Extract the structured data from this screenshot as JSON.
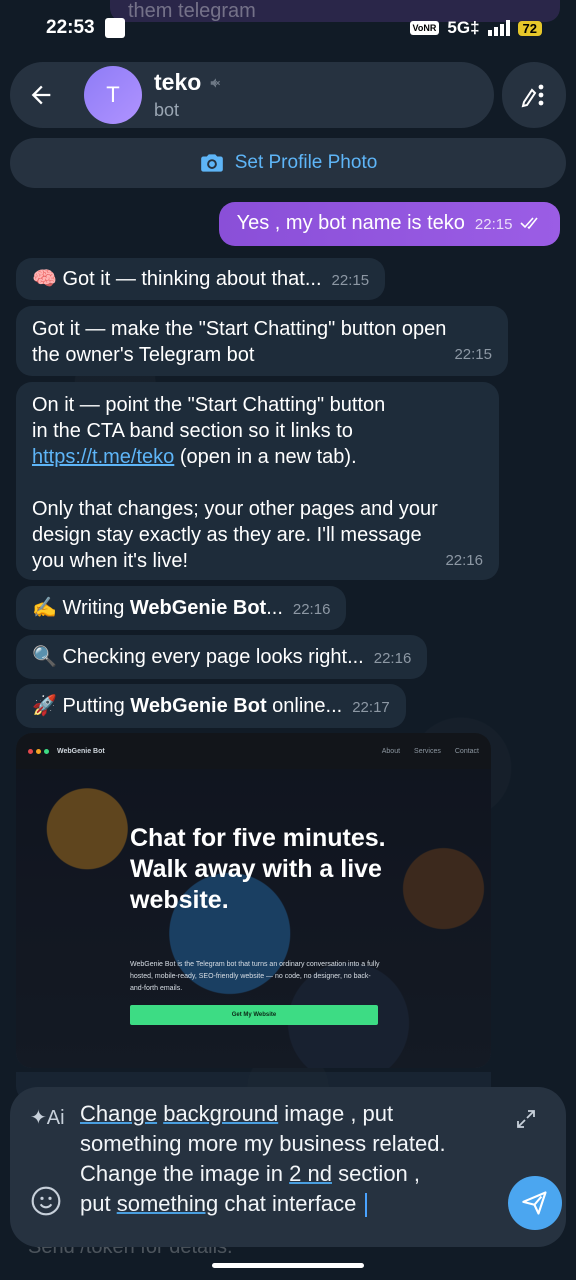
{
  "status_bar": {
    "time": "22:53",
    "volte": "VoNR",
    "network": "5G‡",
    "battery": "72"
  },
  "ghost": {
    "top_text": "them telegram",
    "bottom_text": "Send /token for details."
  },
  "header": {
    "avatar_letter": "T",
    "name": "teko",
    "subtitle": "bot",
    "set_photo_label": "Set Profile Photo"
  },
  "messages": {
    "outgoing": {
      "text": "Yes , my bot name is teko",
      "time": "22:15"
    },
    "m1": {
      "emoji": "🧠",
      "text": "Got it — thinking about that...",
      "time": "22:15"
    },
    "m2": {
      "line1": "Got it — make the \"Start Chatting\" button open",
      "line2": "the owner's Telegram bot",
      "time": "22:15"
    },
    "m3": {
      "line1": "On it — point the \"Start Chatting\" button",
      "line2": "in the CTA band section so it links to",
      "link": "https://t.me/teko",
      "after_link": " (open in a new tab).",
      "line4": "Only that changes; your other pages and your",
      "line5": "design stay exactly as they are. I'll message",
      "line6": "you when it's live!",
      "time": "22:16"
    },
    "m4": {
      "emoji": "✍️",
      "prefix": "Writing ",
      "bold": "WebGenie Bot",
      "suffix": "...",
      "time": "22:16"
    },
    "m5": {
      "emoji": "🔍",
      "text": "Checking every page looks right...",
      "time": "22:16"
    },
    "m6": {
      "emoji": "🚀",
      "prefix": "Putting ",
      "bold": "WebGenie Bot",
      "suffix": " online...",
      "time": "22:17"
    }
  },
  "preview": {
    "brand": "WebGenie Bot",
    "nav": [
      "About",
      "Services",
      "Contact"
    ],
    "headline": "Chat for five minutes. Walk away with a live website.",
    "sub": "WebGenie Bot is the Telegram bot that turns an ordinary conversation into a fully hosted, mobile-ready, SEO-friendly website — no code, no designer, no back-and-forth emails.",
    "cta": "Get My Website"
  },
  "composer": {
    "w1": "Change",
    "w2": "background",
    "t1": " image , put",
    "l2": "something more my business related.",
    "l3a": "Change the image in ",
    "l3u": "2 nd",
    "l3b": " section ,",
    "l4a": "put ",
    "l4u": "something",
    "l4b": " chat interface "
  },
  "colors": {
    "outgoing_bubble": "#9b5de5",
    "incoming_bubble": "#1e2c3a",
    "accent": "#5eb5f7",
    "send_button": "#4ba6f0"
  }
}
